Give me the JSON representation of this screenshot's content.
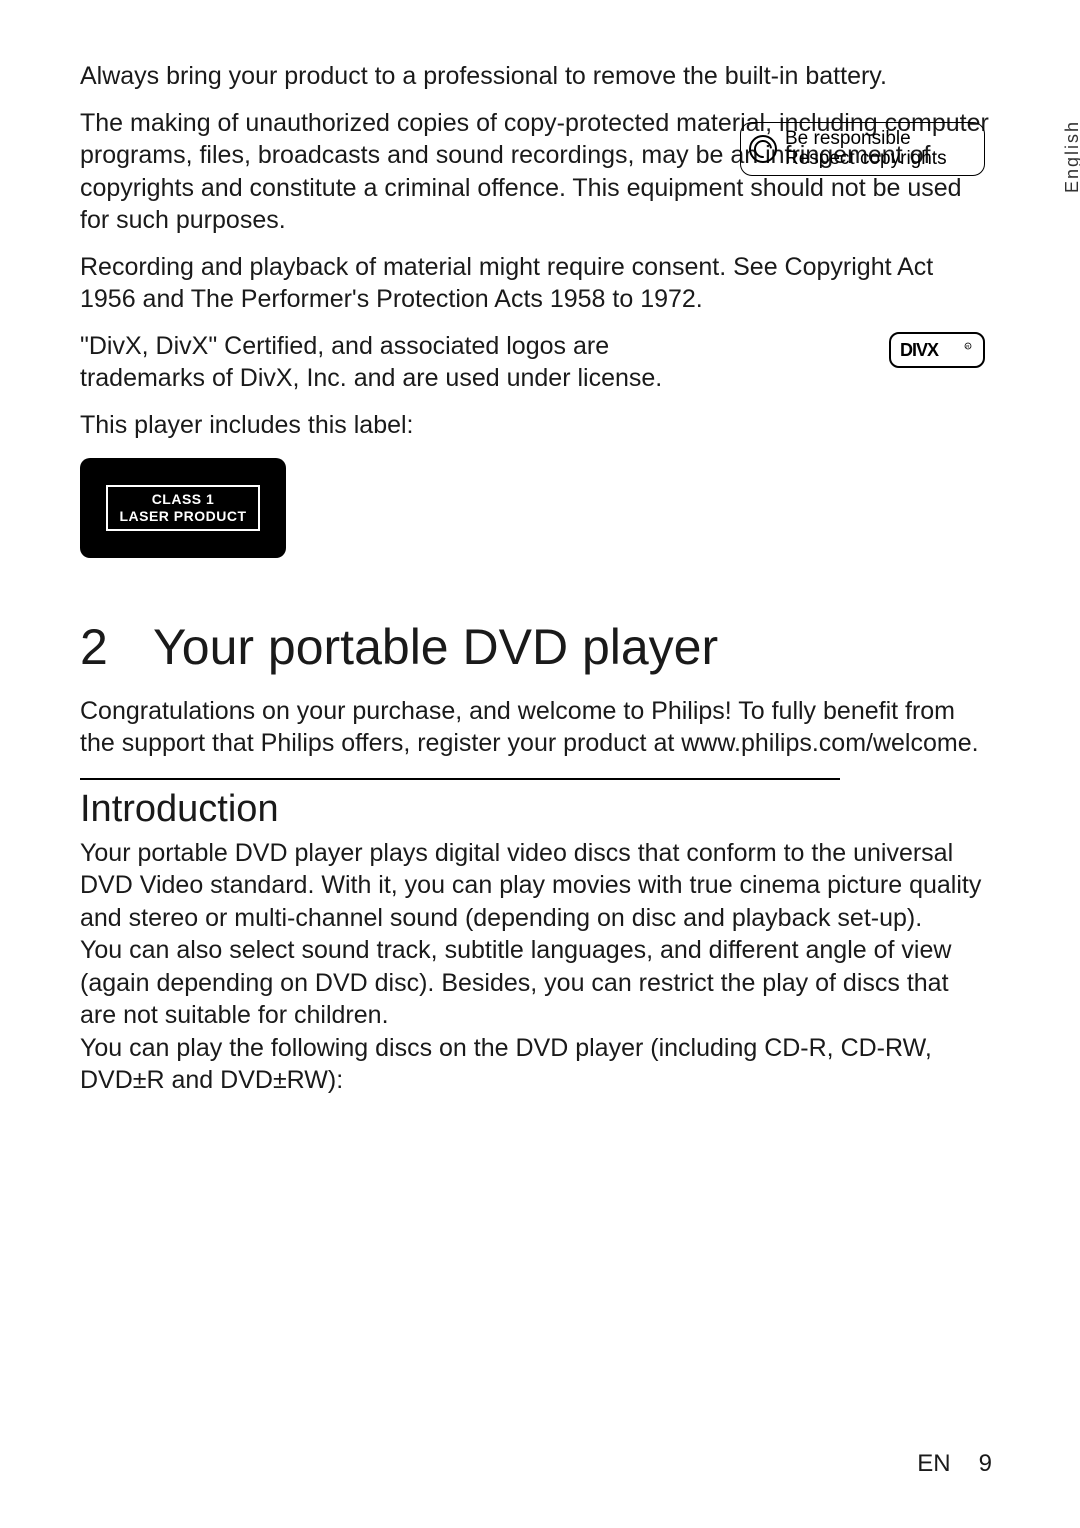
{
  "language_tab": "English",
  "battery_line": "Always bring your product to a professional to remove the built-in battery.",
  "copyright_box": {
    "line1": "Be responsible",
    "line2": "Respect copyrights"
  },
  "copy_paragraph": "The making of unauthorized copies of copy-protected material, including computer programs, files, broadcasts and sound recordings, may be an infringement of copyrights and constitute a criminal offence. This equipment should not be used for such purposes.",
  "recording_paragraph": "Recording and playback of material might require consent. See Copyright Act 1956 and The Performer's Protection Acts 1958 to 1972.",
  "divx_paragraph": "\"DivX, DivX\" Certified, and associated logos are trademarks of DivX, Inc. and are used under license.",
  "divx_logo_text": "DIVX",
  "label_intro": "This player includes this label:",
  "laser_label": {
    "line1": "CLASS 1",
    "line2": "LASER PRODUCT"
  },
  "section": {
    "number": "2",
    "title": "Your portable DVD player"
  },
  "congrats": "Congratulations on your purchase, and welcome to Philips! To fully benefit from the support that Philips offers, register your product at www.philips.com/welcome.",
  "subsection_title": "Introduction",
  "intro_p1": "Your portable DVD player plays digital video discs that conform to the universal DVD Video standard. With it, you can play movies with true cinema picture quality and stereo or multi-channel sound (depending on disc and playback set-up).",
  "intro_p2": "You can also select sound track, subtitle languages, and different angle of view (again depending on DVD disc). Besides, you can restrict the play of discs that are not suitable for children.",
  "intro_p3": "You can play the following discs on the DVD player (including CD-R, CD-RW, DVD±R and DVD±RW):",
  "footer": {
    "lang": "EN",
    "page": "9"
  }
}
